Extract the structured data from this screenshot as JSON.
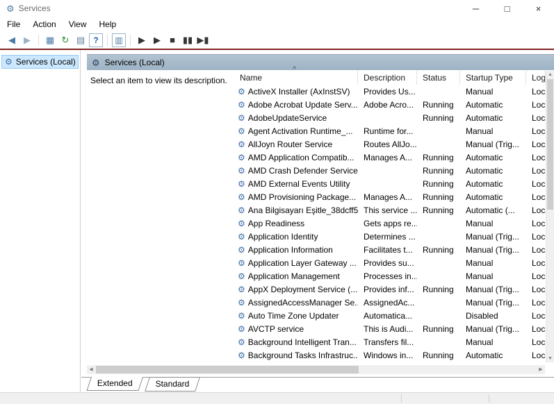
{
  "window": {
    "title": "Services",
    "controls": {
      "minimize": "─",
      "maximize": "□",
      "close": "×"
    }
  },
  "menu": {
    "items": [
      "File",
      "Action",
      "View",
      "Help"
    ]
  },
  "toolbar": {
    "items": [
      {
        "name": "back",
        "glyph": "◀",
        "color": "#4a7aa8"
      },
      {
        "name": "forward",
        "glyph": "▶",
        "color": "#9db3c4"
      },
      {
        "type": "sep"
      },
      {
        "name": "show-console-tree",
        "glyph": "▦",
        "color": "#4a7aa8"
      },
      {
        "name": "refresh",
        "glyph": "↻",
        "color": "#2e8b2e"
      },
      {
        "name": "export-list",
        "glyph": "▤",
        "color": "#5f7f9f"
      },
      {
        "name": "help",
        "glyph": "?",
        "color": "#1f5fbf",
        "boxed": true
      },
      {
        "type": "sep"
      },
      {
        "name": "show-description",
        "glyph": "▥",
        "color": "#4a7aa8",
        "boxed": true
      },
      {
        "type": "sep"
      },
      {
        "name": "start-service",
        "glyph": "▶",
        "color": "#333333"
      },
      {
        "name": "resume-service",
        "glyph": "▶",
        "color": "#333333"
      },
      {
        "name": "stop-service",
        "glyph": "■",
        "color": "#333333"
      },
      {
        "name": "pause-service",
        "glyph": "▮▮",
        "color": "#333333"
      },
      {
        "name": "restart-service",
        "glyph": "▶▮",
        "color": "#333333"
      }
    ]
  },
  "sidebar": {
    "root_label": "Services (Local)"
  },
  "main": {
    "header": "Services (Local)",
    "hint": "Select an item to view its description.",
    "table": {
      "sort_indicator": "^",
      "columns": [
        "Name",
        "Description",
        "Status",
        "Startup Type",
        "Log"
      ],
      "rows": [
        {
          "name": "ActiveX Installer (AxInstSV)",
          "description": "Provides Us...",
          "status": "",
          "startup_type": "Manual",
          "log_on_as": "Loc..."
        },
        {
          "name": "Adobe Acrobat Update Serv...",
          "description": "Adobe Acro...",
          "status": "Running",
          "startup_type": "Automatic",
          "log_on_as": "Loc..."
        },
        {
          "name": "AdobeUpdateService",
          "description": "",
          "status": "Running",
          "startup_type": "Automatic",
          "log_on_as": "Loc..."
        },
        {
          "name": "Agent Activation Runtime_...",
          "description": "Runtime for...",
          "status": "",
          "startup_type": "Manual",
          "log_on_as": "Loc..."
        },
        {
          "name": "AllJoyn Router Service",
          "description": "Routes AllJo...",
          "status": "",
          "startup_type": "Manual (Trig...",
          "log_on_as": "Loc..."
        },
        {
          "name": "AMD Application Compatib...",
          "description": "Manages A...",
          "status": "Running",
          "startup_type": "Automatic",
          "log_on_as": "Loc..."
        },
        {
          "name": "AMD Crash Defender Service",
          "description": "",
          "status": "Running",
          "startup_type": "Automatic",
          "log_on_as": "Loc..."
        },
        {
          "name": "AMD External Events Utility",
          "description": "",
          "status": "Running",
          "startup_type": "Automatic",
          "log_on_as": "Loc..."
        },
        {
          "name": "AMD Provisioning Package...",
          "description": "Manages A...",
          "status": "Running",
          "startup_type": "Automatic",
          "log_on_as": "Loc..."
        },
        {
          "name": "Ana Bilgisayarı Eşitle_38dcff5",
          "description": "This service ...",
          "status": "Running",
          "startup_type": "Automatic (...",
          "log_on_as": "Loc..."
        },
        {
          "name": "App Readiness",
          "description": "Gets apps re...",
          "status": "",
          "startup_type": "Manual",
          "log_on_as": "Loc..."
        },
        {
          "name": "Application Identity",
          "description": "Determines ...",
          "status": "",
          "startup_type": "Manual (Trig...",
          "log_on_as": "Loc..."
        },
        {
          "name": "Application Information",
          "description": "Facilitates t...",
          "status": "Running",
          "startup_type": "Manual (Trig...",
          "log_on_as": "Loc..."
        },
        {
          "name": "Application Layer Gateway ...",
          "description": "Provides su...",
          "status": "",
          "startup_type": "Manual",
          "log_on_as": "Loc..."
        },
        {
          "name": "Application Management",
          "description": "Processes in...",
          "status": "",
          "startup_type": "Manual",
          "log_on_as": "Loc..."
        },
        {
          "name": "AppX Deployment Service (...",
          "description": "Provides inf...",
          "status": "Running",
          "startup_type": "Manual (Trig...",
          "log_on_as": "Loc..."
        },
        {
          "name": "AssignedAccessManager Se...",
          "description": "AssignedAc...",
          "status": "",
          "startup_type": "Manual (Trig...",
          "log_on_as": "Loc..."
        },
        {
          "name": "Auto Time Zone Updater",
          "description": "Automatica...",
          "status": "",
          "startup_type": "Disabled",
          "log_on_as": "Loc..."
        },
        {
          "name": "AVCTP service",
          "description": "This is Audi...",
          "status": "Running",
          "startup_type": "Manual (Trig...",
          "log_on_as": "Loc..."
        },
        {
          "name": "Background Intelligent Tran...",
          "description": "Transfers fil...",
          "status": "",
          "startup_type": "Manual",
          "log_on_as": "Loc..."
        },
        {
          "name": "Background Tasks Infrastruc...",
          "description": "Windows in...",
          "status": "Running",
          "startup_type": "Automatic",
          "log_on_as": "Loc..."
        }
      ]
    },
    "tabs": [
      {
        "label": "Extended"
      },
      {
        "label": "Standard"
      }
    ]
  },
  "icons": {
    "app": "⚙",
    "tree_root": "⚙",
    "band": "⚙",
    "service_gear": "⚙",
    "scroll_up": "▲",
    "scroll_down": "▼",
    "scroll_left": "◀",
    "scroll_right": "▶"
  },
  "colors": {
    "accent_line": "#7e2121",
    "selection_bg": "#cce8ff",
    "selection_border": "#93cbf2",
    "band_from": "#b3c3d1",
    "band_to": "#9db3c5"
  }
}
